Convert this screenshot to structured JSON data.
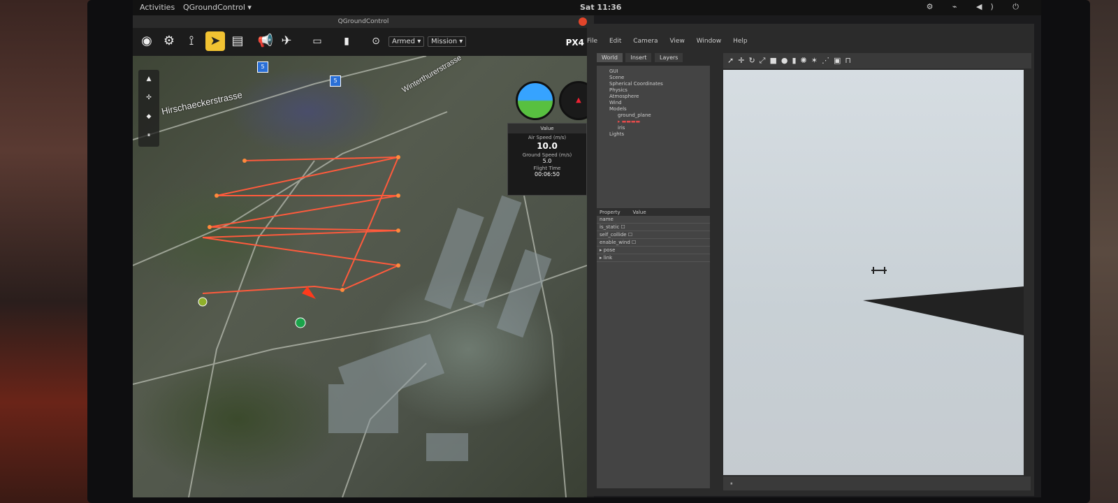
{
  "topbar": {
    "activities": "Activities",
    "app": "QGroundControl ▾",
    "clock": "Sat 11:36"
  },
  "qgc": {
    "title": "QGroundControl",
    "toolbar": {
      "armed": "Armed ▾",
      "mode": "Mission ▾",
      "logo": "PX4"
    },
    "map_labels": {
      "street1": "Hirschaeckerstrasse",
      "street2": "Winterthurerstrasse"
    },
    "markers": [
      "5",
      "5"
    ],
    "instrument_values": {
      "header": "Value",
      "air_speed_label": "Air Speed (m/s)",
      "air_speed_value": "10.0",
      "ground_speed_label": "Ground Speed (m/s)",
      "ground_speed_value": "5.0",
      "flight_time_label": "Flight Time",
      "flight_time_value": "00:06:50"
    }
  },
  "gazebo": {
    "menu": [
      "File",
      "Edit",
      "Camera",
      "View",
      "Window",
      "Help"
    ],
    "tabs": [
      "World",
      "Insert",
      "Layers"
    ],
    "tree": [
      "GUI",
      "Scene",
      "Spherical Coordinates",
      "Physics",
      "Atmosphere",
      "Wind",
      "Models"
    ],
    "models": [
      "ground_plane",
      "iris"
    ],
    "tree_tail": "Lights",
    "props_header": [
      "Property",
      "Value"
    ],
    "props_rows": [
      "name",
      "is_static",
      "self_collide",
      "enable_wind",
      "pose",
      "link"
    ]
  }
}
